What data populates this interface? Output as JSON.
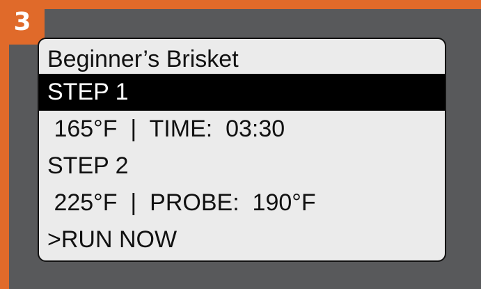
{
  "badge": {
    "number": "3"
  },
  "screen": {
    "title": "Beginner’s Brisket",
    "rows": [
      {
        "text": "STEP 1",
        "selected": true
      },
      {
        "text": " 165°F  |  TIME:  03:30",
        "selected": false
      },
      {
        "text": "STEP 2",
        "selected": false
      },
      {
        "text": " 225°F  |  PROBE:  190°F",
        "selected": false
      },
      {
        "text": ">RUN NOW",
        "selected": false
      }
    ]
  },
  "colors": {
    "accent": "#e06a2a",
    "panel": "#58595b",
    "screen_bg": "#ebebeb",
    "highlight_bg": "#000000"
  }
}
